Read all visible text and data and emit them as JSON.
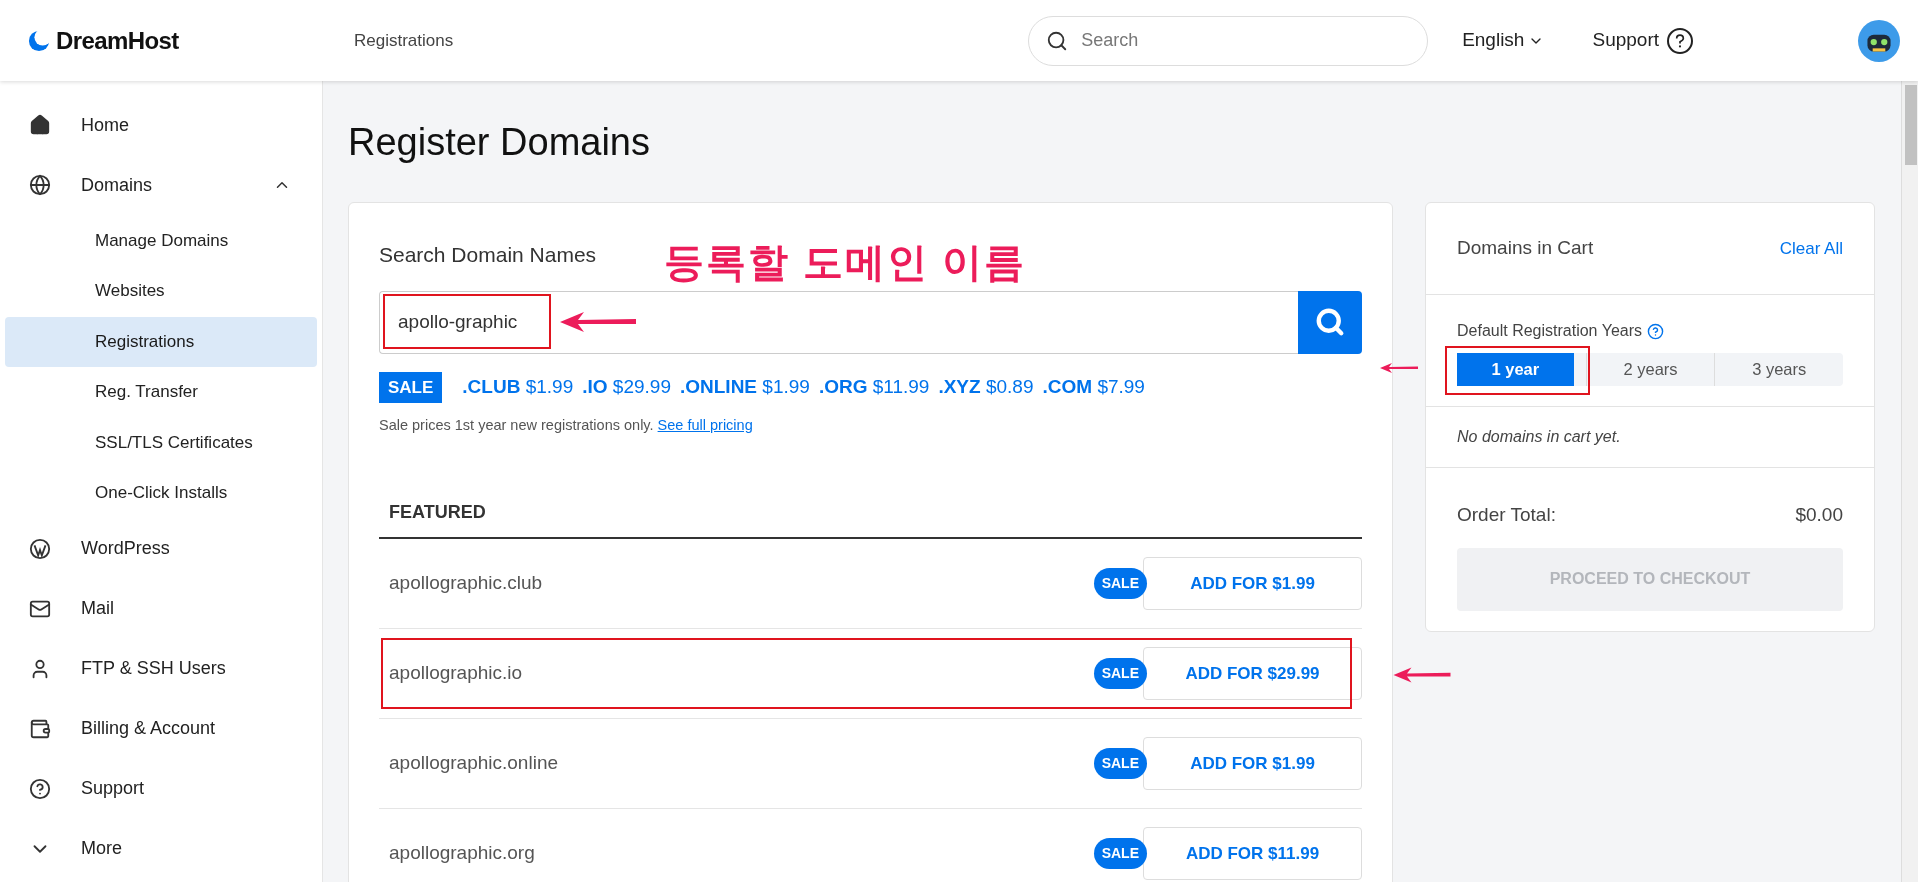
{
  "header": {
    "brand": "DreamHost",
    "breadcrumb": "Registrations",
    "search_placeholder": "Search",
    "language": "English",
    "support": "Support"
  },
  "sidebar": {
    "items": [
      {
        "label": "Home",
        "selected": false
      },
      {
        "label": "Domains",
        "selected": false,
        "expanded": true,
        "children": [
          {
            "label": "Manage Domains",
            "selected": false
          },
          {
            "label": "Websites",
            "selected": false
          },
          {
            "label": "Registrations",
            "selected": true
          },
          {
            "label": "Reg. Transfer",
            "selected": false
          },
          {
            "label": "SSL/TLS Certificates",
            "selected": false
          },
          {
            "label": "One-Click Installs",
            "selected": false
          }
        ]
      },
      {
        "label": "WordPress",
        "selected": false
      },
      {
        "label": "Mail",
        "selected": false
      },
      {
        "label": "FTP & SSH Users",
        "selected": false
      },
      {
        "label": "Billing & Account",
        "selected": false
      },
      {
        "label": "Support",
        "selected": false
      },
      {
        "label": "More",
        "selected": false
      }
    ]
  },
  "page_title": "Register Domains",
  "search": {
    "heading": "Search Domain Names",
    "value": "apollo-graphic",
    "highlighted": true,
    "annotation": "등록할 도메인 이름"
  },
  "sale": {
    "badge": "SALE",
    "prices": [
      {
        "tld": ".CLUB",
        "price": "$1.99"
      },
      {
        "tld": ".IO",
        "price": "$29.99"
      },
      {
        "tld": ".ONLINE",
        "price": "$1.99"
      },
      {
        "tld": ".ORG",
        "price": "$11.99"
      },
      {
        "tld": ".XYZ",
        "price": "$0.89"
      },
      {
        "tld": ".COM",
        "price": "$7.99"
      }
    ],
    "note": "Sale prices 1st year new registrations only.",
    "link": "See full pricing"
  },
  "featured": {
    "heading": "FEATURED",
    "rows": [
      {
        "domain": "apollographic.club",
        "badge": "SALE",
        "action": "ADD FOR $1.99",
        "highlighted": false
      },
      {
        "domain": "apollographic.io",
        "badge": "SALE",
        "action": "ADD FOR $29.99",
        "highlighted": true
      },
      {
        "domain": "apollographic.online",
        "badge": "SALE",
        "action": "ADD FOR $1.99",
        "highlighted": false
      },
      {
        "domain": "apollographic.org",
        "badge": "SALE",
        "action": "ADD FOR $11.99",
        "highlighted": false
      }
    ]
  },
  "cart": {
    "title": "Domains in Cart",
    "clear": "Clear All",
    "years_label": "Default Registration Years",
    "years": [
      {
        "label": "1 year",
        "selected": true,
        "highlighted": true
      },
      {
        "label": "2 years",
        "selected": false,
        "highlighted": false
      },
      {
        "label": "3 years",
        "selected": false,
        "highlighted": false
      }
    ],
    "empty": "No domains in cart yet.",
    "total_label": "Order Total:",
    "total": "$0.00",
    "checkout": "PROCEED TO CHECKOUT"
  }
}
